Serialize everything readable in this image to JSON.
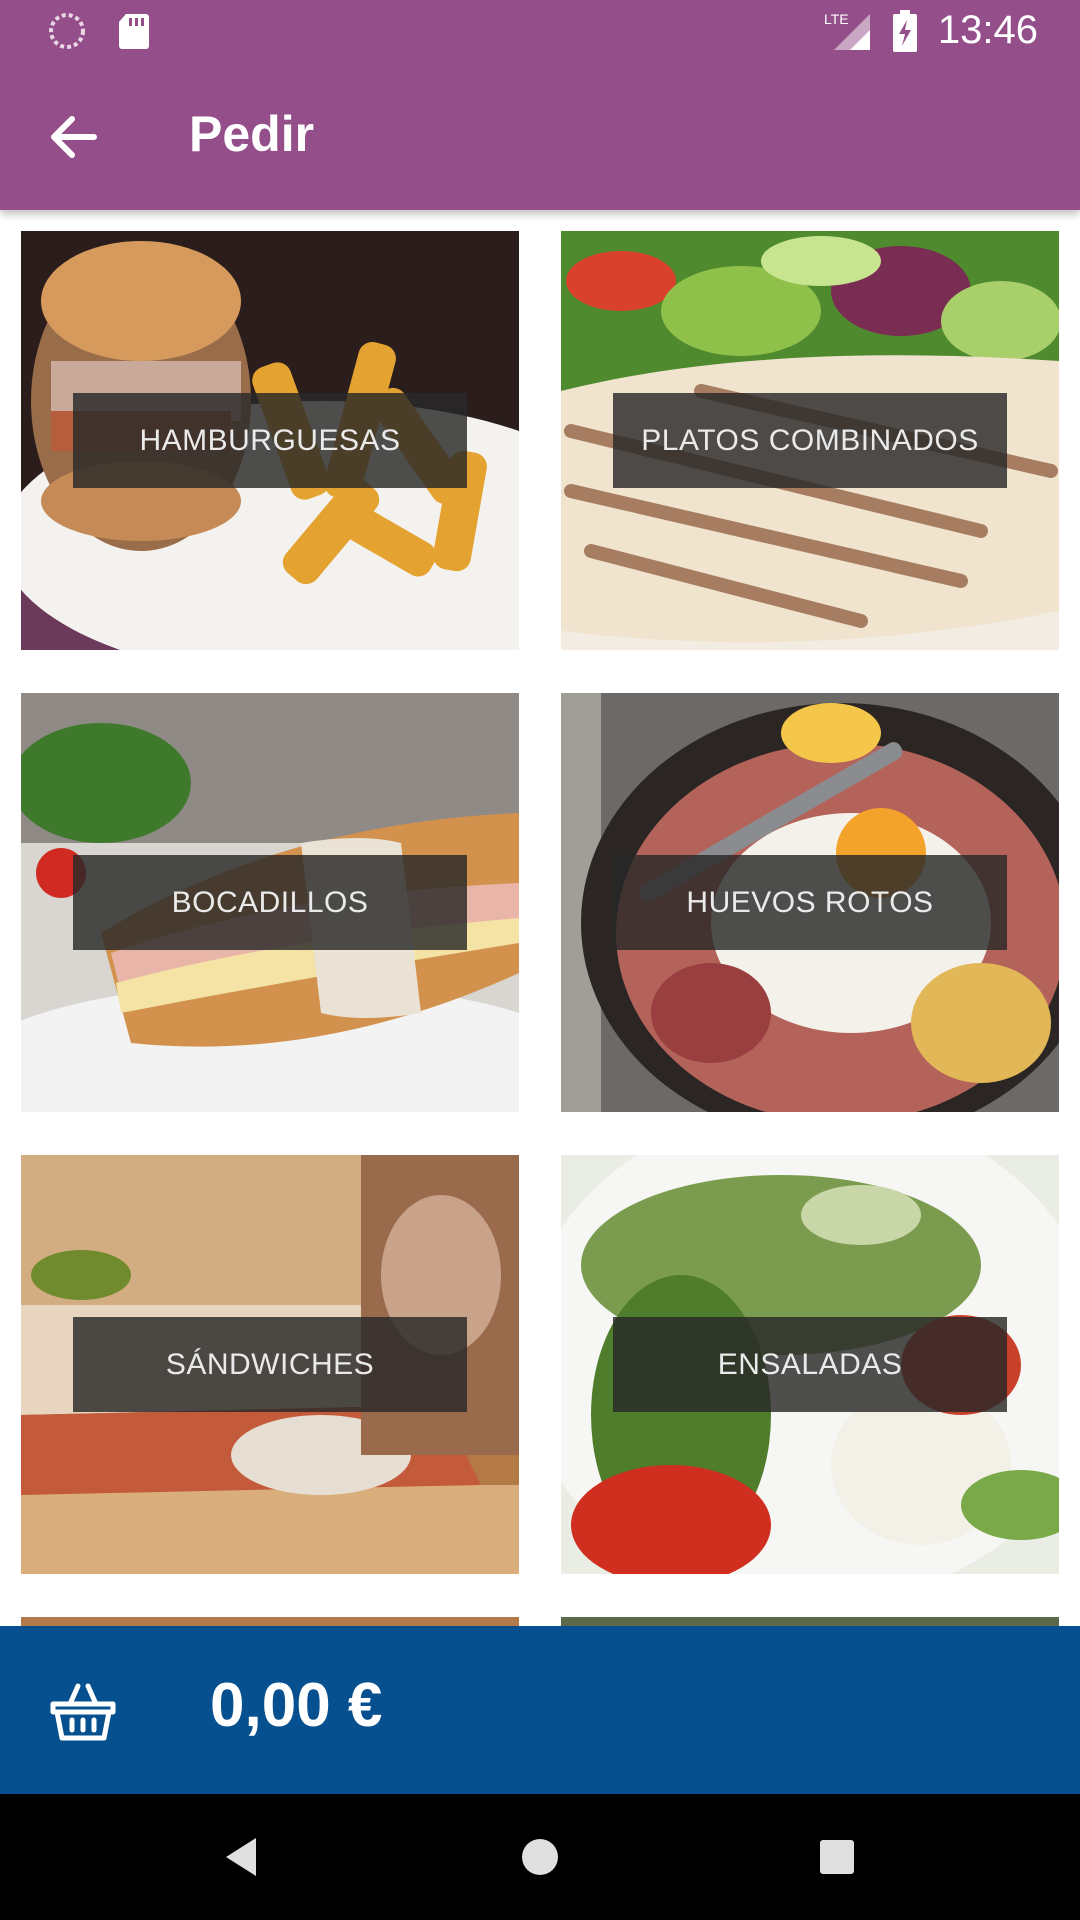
{
  "status_bar": {
    "time": "13:46",
    "network": "LTE",
    "icons": [
      "loading-icon",
      "sd-card-icon",
      "signal-icon",
      "battery-charging-icon"
    ]
  },
  "toolbar": {
    "title": "Pedir",
    "back_icon": "arrow-left-icon"
  },
  "categories": [
    {
      "label": "HAMBURGUESAS",
      "theme": "burger-fries"
    },
    {
      "label": "PLATOS COMBINADOS",
      "theme": "grilled-chicken-salad"
    },
    {
      "label": "BOCADILLOS",
      "theme": "baguette"
    },
    {
      "label": "HUEVOS ROTOS",
      "theme": "egg-pan"
    },
    {
      "label": "SÁNDWICHES",
      "theme": "toasted-sandwich"
    },
    {
      "label": "ENSALADAS",
      "theme": "caprese-salad"
    }
  ],
  "cart": {
    "icon": "basket-icon",
    "total": "0,00 €"
  },
  "nav": {
    "icons": [
      "back-triangle-icon",
      "home-circle-icon",
      "recents-square-icon"
    ]
  },
  "colors": {
    "primary": "#944f8a",
    "cart_bar": "#06508f",
    "label_bg": "#282828"
  }
}
